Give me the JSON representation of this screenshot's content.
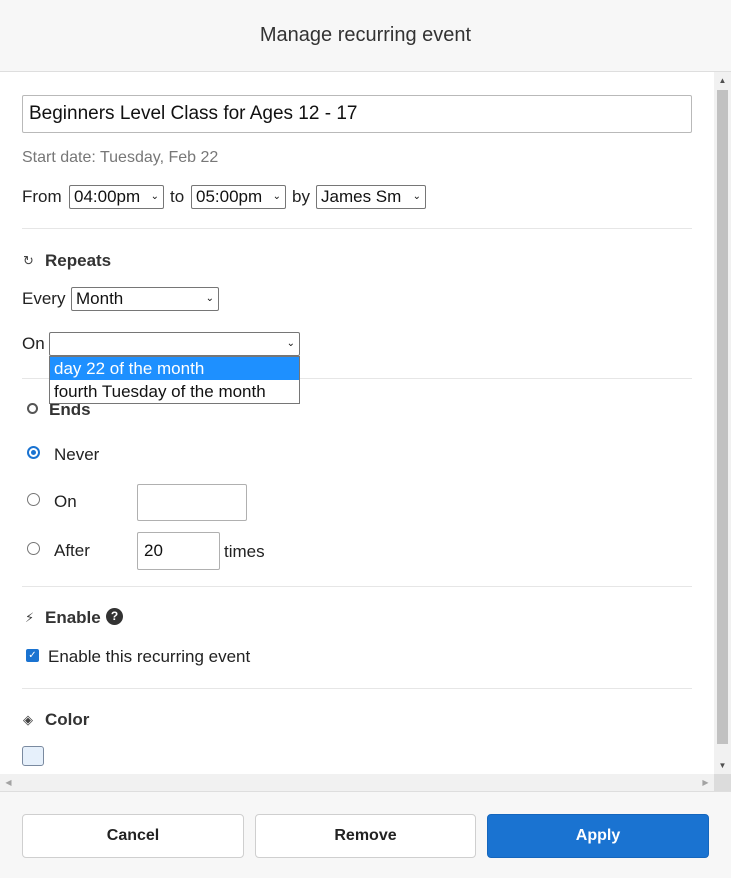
{
  "dialog": {
    "title": "Manage recurring event"
  },
  "event": {
    "name": "Beginners Level Class for Ages 12 - 17",
    "start_date": "Start date: Tuesday, Feb 22",
    "from_label": "From",
    "from_value": "04:00pm",
    "to_label": "to",
    "to_value": "05:00pm",
    "by_label": "by",
    "by_value": "James Sm"
  },
  "repeats": {
    "title": "Repeats",
    "every_label": "Every",
    "every_value": "Month",
    "on_label": "On",
    "on_value": "",
    "options": [
      "day 22 of the month",
      "fourth Tuesday of the month"
    ],
    "highlighted_option": "day 22 of the month"
  },
  "ends": {
    "title": "Ends",
    "never_label": "Never",
    "on_label": "On",
    "on_value": "",
    "after_label": "After",
    "after_value": "20",
    "times_label": "times",
    "selected": "Never"
  },
  "enable": {
    "title": "Enable",
    "help_glyph": "?",
    "checkbox_label": "Enable this recurring event",
    "checked": true
  },
  "color": {
    "title": "Color",
    "value": "#e6f0fb"
  },
  "footer": {
    "cancel_label": "Cancel",
    "remove_label": "Remove",
    "apply_label": "Apply"
  },
  "theme": {
    "accent": "#1a73d1",
    "highlight": "#1e90ff"
  },
  "icons": {
    "repeats": "refresh-icon",
    "ends": "circle-icon",
    "enable": "lightning-icon",
    "color": "paint-bucket-icon"
  }
}
